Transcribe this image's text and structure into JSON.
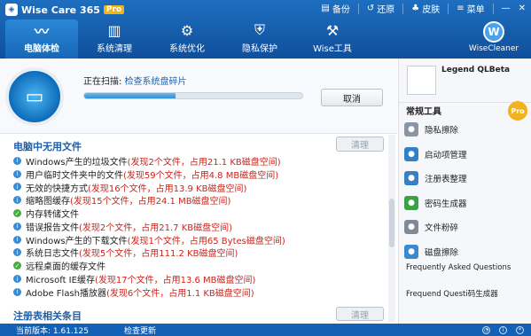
{
  "app": {
    "name": "Wise Care 365",
    "edition": "Pro"
  },
  "window_menu": {
    "backup": "备份",
    "restore": "还原",
    "skin": "皮肤",
    "menu": "菜单"
  },
  "nav": [
    {
      "label": "电脑体检",
      "icon": "pulse-icon",
      "active": true
    },
    {
      "label": "系统清理",
      "icon": "broom-icon",
      "active": false
    },
    {
      "label": "系统优化",
      "icon": "gear-icon",
      "active": false
    },
    {
      "label": "隐私保护",
      "icon": "shield-icon",
      "active": false
    },
    {
      "label": "Wise工具",
      "icon": "tools-icon",
      "active": false
    }
  ],
  "brand": {
    "letter": "W",
    "name": "WiseCleaner"
  },
  "scan": {
    "prefix": "正在扫描: ",
    "task": "检查系统盘碎片",
    "progress": 0.42,
    "cancel": "取消"
  },
  "sections": {
    "junk": "电脑中无用文件",
    "clean": "清理",
    "registry": "注册表相关条目"
  },
  "items": [
    {
      "type": "info",
      "name": "Windows产生的垃圾文件",
      "detail": " (发现2个文件，占用21.1 KB磁盘空间)"
    },
    {
      "type": "info",
      "name": "用户临时文件夹中的文件",
      "detail": " (发现59个文件，占用4.8 MB磁盘空间)"
    },
    {
      "type": "info",
      "name": "无效的快捷方式",
      "detail": " (发现16个文件，占用13.9 KB磁盘空间)"
    },
    {
      "type": "info",
      "name": "缩略图缓存",
      "detail": " (发现15个文件，占用24.1 MB磁盘空间)"
    },
    {
      "type": "ok",
      "name": "内存转储文件",
      "detail": ""
    },
    {
      "type": "info",
      "name": "错误报告文件",
      "detail": " (发现2个文件，占用21.7 KB磁盘空间)"
    },
    {
      "type": "info",
      "name": "Windows产生的下载文件",
      "detail": " (发现1个文件，占用65 Bytes磁盘空间)"
    },
    {
      "type": "info",
      "name": "系统日志文件",
      "detail": " (发现5个文件，占用111.2 KB磁盘空间)"
    },
    {
      "type": "ok",
      "name": "远程桌面的缓存文件",
      "detail": ""
    },
    {
      "type": "info",
      "name": "Microsoft IE缓存",
      "detail": " (发现17个文件，占用13.6 MB磁盘空间)"
    },
    {
      "type": "info",
      "name": "Adobe Flash播放器",
      "detail": " (发现6个文件，占用1.1 KB磁盘空间)"
    }
  ],
  "side": {
    "username": "Legend QLBeta",
    "tools_title": "常规工具",
    "pro": "Pro",
    "tools": [
      {
        "label": "隐私擦除",
        "icon": "eye-icon",
        "color": "#8a95a3"
      },
      {
        "label": "启动项管理",
        "icon": "power-icon",
        "color": "#2f80c8"
      },
      {
        "label": "注册表整理",
        "icon": "registry-icon",
        "color": "#3a7fc4"
      },
      {
        "label": "密码生成器",
        "icon": "key-icon",
        "color": "#3aa145"
      },
      {
        "label": "文件粉碎",
        "icon": "shredder-icon",
        "color": "#7f8a96"
      },
      {
        "label": "磁盘擦除",
        "icon": "disk-icon",
        "color": "#3b8ad1"
      }
    ],
    "faq": "Frequently Asked Questions",
    "faq2": "Frequend Questi",
    "faq2_overlap": "码生成器"
  },
  "status": {
    "version": "当前版本: 1.61.125",
    "update": "检查更新"
  }
}
